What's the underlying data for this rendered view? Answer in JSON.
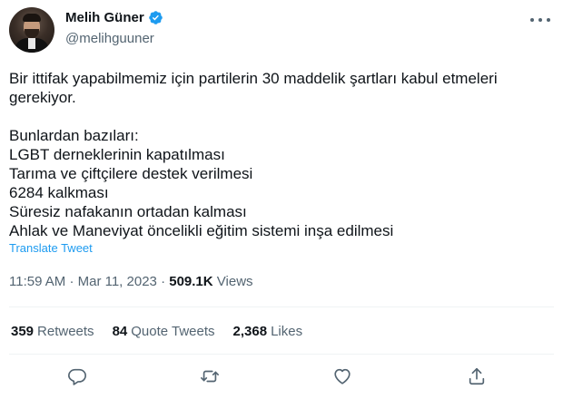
{
  "author": {
    "name": "Melih Güner",
    "handle": "@melihguuner",
    "verified_color": "#1d9bf0"
  },
  "tweet": {
    "lines": [
      "Bir ittifak yapabilmemiz için partilerin 30 maddelik şartları kabul etmeleri",
      "gerekiyor.",
      "",
      "Bunlardan bazıları:",
      "LGBT derneklerinin kapatılması",
      "Tarıma ve çiftçilere destek verilmesi",
      "6284 kalkması",
      "Süresiz nafakanın ortadan kalması",
      "Ahlak ve Maneviyat öncelikli eğitim sistemi inşa edilmesi"
    ],
    "translate_label": "Translate Tweet"
  },
  "meta": {
    "time": "11:59 AM",
    "separator": "·",
    "date": "Mar 11, 2023",
    "views_count": "509.1K",
    "views_label": "Views"
  },
  "stats": [
    {
      "count": "359",
      "label": "Retweets"
    },
    {
      "count": "84",
      "label": "Quote Tweets"
    },
    {
      "count": "2,368",
      "label": "Likes"
    }
  ],
  "actions": [
    "reply-icon",
    "retweet-icon",
    "like-icon",
    "share-icon"
  ],
  "colors": {
    "text": "#0f1419",
    "muted": "#536471",
    "link": "#1d9bf0",
    "divider": "#eff3f4"
  }
}
